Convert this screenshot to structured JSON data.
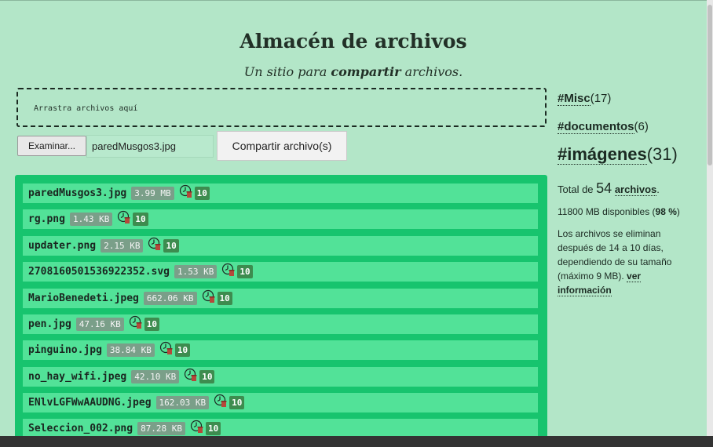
{
  "header": {
    "title": "Almacén de archivos",
    "subtitle_pre": "Un sitio para ",
    "subtitle_bold": "compartir",
    "subtitle_post": " archivos."
  },
  "upload": {
    "dropzone_text": "Arrastra archivos aquí",
    "browse_label": "Examinar...",
    "selected_file": "paredMusgos3.jpg",
    "share_label": "Compartir archivo(s)"
  },
  "files": [
    {
      "name": "paredMusgos3.jpg",
      "size": "3.99 MB",
      "count": "10"
    },
    {
      "name": "rg.png",
      "size": "1.43 KB",
      "count": "10"
    },
    {
      "name": "updater.png",
      "size": "2.15 KB",
      "count": "10"
    },
    {
      "name": "2708160501536922352.svg",
      "size": "1.53 KB",
      "count": "10"
    },
    {
      "name": "MarioBenedeti.jpeg",
      "size": "662.06 KB",
      "count": "10"
    },
    {
      "name": "pen.jpg",
      "size": "47.16 KB",
      "count": "10"
    },
    {
      "name": "pinguino.jpg",
      "size": "38.84 KB",
      "count": "10"
    },
    {
      "name": "no_hay_wifi.jpeg",
      "size": "42.10 KB",
      "count": "10"
    },
    {
      "name": "ENlvLGFWwAAUDNG.jpeg",
      "size": "162.03 KB",
      "count": "10"
    },
    {
      "name": "Seleccion_002.png",
      "size": "87.28 KB",
      "count": "10"
    }
  ],
  "sidebar": {
    "tags": [
      {
        "name": "#Misc",
        "count": "(17)"
      },
      {
        "name": "#documentos",
        "count": "(6)"
      },
      {
        "name": "#imágenes",
        "count": "(31)"
      }
    ],
    "total_pre": "Total de ",
    "total_num": "54",
    "total_link": "archivos",
    "total_post": ".",
    "disk_pre": "11800 MB disponibles (",
    "disk_pct": "98 %",
    "disk_post": ")",
    "note": "Los archivos se eliminan después de 14 a 10 días, dependiendo de su tamaño (máximo 9 MB).",
    "note_link": "ver información"
  },
  "icons": {
    "timer": "clock-trash-icon"
  },
  "colors": {
    "background": "#b3e6c8",
    "list_bg": "#17c46e",
    "row_bg": "#52e298",
    "count_badge": "#3d8c4f"
  }
}
